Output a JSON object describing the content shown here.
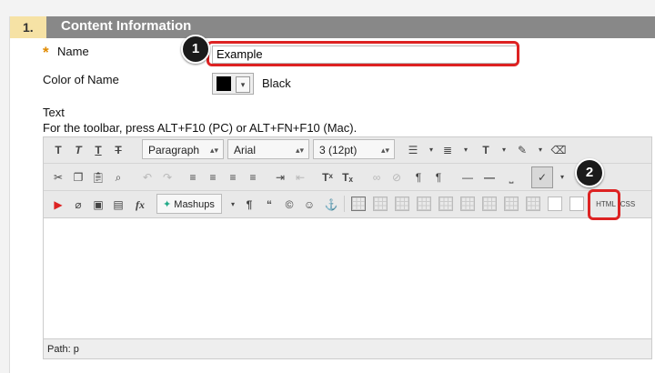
{
  "section": {
    "number": "1.",
    "title": "Content Information"
  },
  "name_field": {
    "label": "Name",
    "value": "Example",
    "required_mark": "*"
  },
  "color_field": {
    "label": "Color of Name",
    "value": "Black",
    "swatch_color": "#000000"
  },
  "text_field": {
    "label": "Text",
    "hint": "For the toolbar, press ALT+F10 (PC) or ALT+FN+F10 (Mac)."
  },
  "toolbar": {
    "format": "Paragraph",
    "font": "Arial",
    "size": "3 (12pt)",
    "mashups": "Mashups",
    "html_label": "HTML",
    "css_label": "CSS"
  },
  "editor": {
    "path": "Path: p"
  },
  "callouts": [
    "1",
    "2"
  ],
  "colors": {
    "highlight": "#dd2222",
    "header": "#888888",
    "header_num_bg": "#f6e2a5",
    "required": "#e08a00"
  }
}
